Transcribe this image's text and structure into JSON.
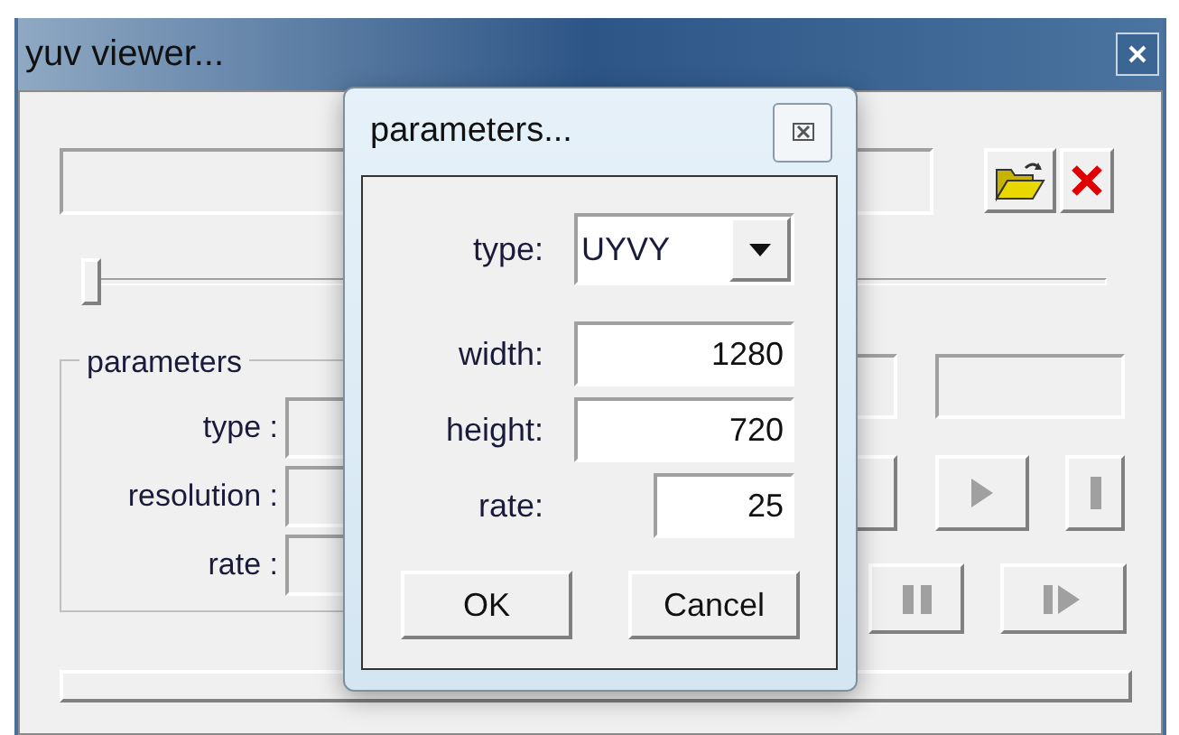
{
  "main_window": {
    "title": "yuv viewer...",
    "position_slider": {
      "level": 0
    },
    "parameters_group": {
      "title": "parameters",
      "fields": [
        {
          "label": "type :"
        },
        {
          "label": "resolution :"
        },
        {
          "label": "rate :"
        }
      ]
    }
  },
  "dialog": {
    "title": "parameters...",
    "type": {
      "label": "type:",
      "value": "UYVY"
    },
    "fields": [
      {
        "label": "width:",
        "value": "1280",
        "kind": "wide"
      },
      {
        "label": "height:",
        "value": "720",
        "kind": "wide"
      },
      {
        "label": "rate:",
        "value": "25",
        "kind": "narrow"
      }
    ],
    "buttons": [
      "OK",
      "Cancel"
    ]
  }
}
